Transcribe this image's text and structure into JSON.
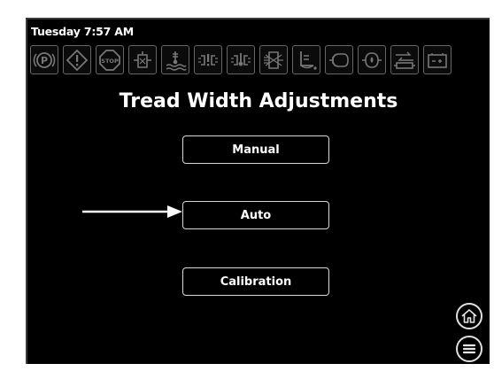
{
  "status": {
    "clock": "Tuesday 7:57 AM"
  },
  "indicators": [
    {
      "name": "park-brake-icon"
    },
    {
      "name": "warning-icon"
    },
    {
      "name": "stop-icon",
      "label": "STOP"
    },
    {
      "name": "hydraulic-filter-icon"
    },
    {
      "name": "coolant-temperature-icon"
    },
    {
      "name": "transmission-warning-icon"
    },
    {
      "name": "transmission-temperature-icon"
    },
    {
      "name": "air-filter-icon"
    },
    {
      "name": "engine-oil-icon"
    },
    {
      "name": "engine-warning-icon"
    },
    {
      "name": "oil-pressure-icon"
    },
    {
      "name": "fuel-filter-icon"
    },
    {
      "name": "battery-icon"
    }
  ],
  "page": {
    "title": "Tread Width Adjustments"
  },
  "menu": {
    "manual": "Manual",
    "auto": "Auto",
    "calibration": "Calibration"
  },
  "nav": {
    "home_icon": "home-icon",
    "menu_icon": "hamburger-menu-icon"
  },
  "colors": {
    "screen_bg": "#000000",
    "foreground": "#ffffff",
    "icon_gray": "#777777"
  }
}
